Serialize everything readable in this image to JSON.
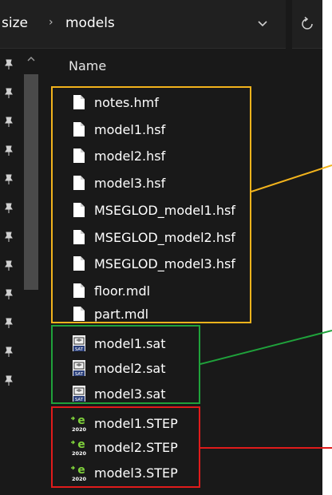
{
  "address": {
    "crumb_parent": "size",
    "crumb_separator": "›",
    "crumb_current": "models",
    "dropdown_icon": "chevron-down-icon",
    "refresh_icon": "refresh-icon"
  },
  "file_list": {
    "column_header": "Name",
    "files": [
      {
        "name": "notes.hmf",
        "icon": "blank-file-icon"
      },
      {
        "name": "model1.hsf",
        "icon": "blank-file-icon"
      },
      {
        "name": "model2.hsf",
        "icon": "blank-file-icon"
      },
      {
        "name": "model3.hsf",
        "icon": "blank-file-icon"
      },
      {
        "name": "MSEGLOD_model1.hsf",
        "icon": "blank-file-icon"
      },
      {
        "name": "MSEGLOD_model2.hsf",
        "icon": "blank-file-icon"
      },
      {
        "name": "MSEGLOD_model3.hsf",
        "icon": "blank-file-icon"
      },
      {
        "name": "floor.mdl",
        "icon": "blank-file-icon"
      },
      {
        "name": "part.mdl",
        "icon": "blank-file-icon"
      },
      {
        "name": "model1.sat",
        "icon": "acis-sat-file-icon",
        "icon_text": "SAT"
      },
      {
        "name": "model2.sat",
        "icon": "acis-sat-file-icon",
        "icon_text": "SAT"
      },
      {
        "name": "model3.sat",
        "icon": "acis-sat-file-icon",
        "icon_text": "SAT"
      },
      {
        "name": "model1.STEP",
        "icon": "step-2020-file-icon",
        "icon_text": "2020"
      },
      {
        "name": "model2.STEP",
        "icon": "step-2020-file-icon",
        "icon_text": "2020"
      },
      {
        "name": "model3.STEP",
        "icon": "step-2020-file-icon",
        "icon_text": "2020"
      }
    ]
  },
  "annotation_colors": {
    "yellow": "#f2b31c",
    "green": "#1fa23b",
    "red": "#e01b1b"
  },
  "theme": {
    "background": "#191919",
    "text": "#ffffff"
  }
}
